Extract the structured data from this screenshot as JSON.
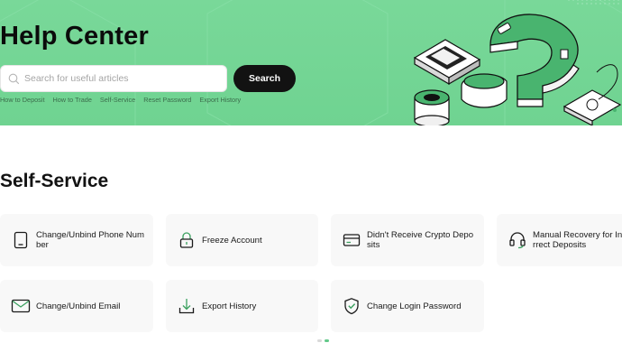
{
  "hero": {
    "title": "Help Center",
    "search_placeholder": "Search for useful articles",
    "search_button": "Search",
    "quick_links": [
      "How to Deposit",
      "How to Trade",
      "Self-Service",
      "Reset Password",
      "Export History"
    ]
  },
  "section": {
    "title": "Self-Service"
  },
  "cards": [
    {
      "label": "Change/Unbind Phone Number",
      "icon": "phone-icon"
    },
    {
      "label": "Freeze Account",
      "icon": "lock-icon"
    },
    {
      "label": "Didn't Receive Crypto Deposits",
      "icon": "card-icon"
    },
    {
      "label": "Manual Recovery for Incorrect Deposits",
      "icon": "headset-icon"
    },
    {
      "label": "Change/Unbind Email",
      "icon": "mail-icon"
    },
    {
      "label": "Export History",
      "icon": "download-icon"
    },
    {
      "label": "Change Login Password",
      "icon": "shield-check-icon"
    }
  ],
  "colors": {
    "hero_green": "#72d594",
    "accent_green": "#3aa05e",
    "button_black": "#121212",
    "card_bg": "#f8f8f8"
  },
  "pagination": {
    "pages": 2,
    "active": 2
  }
}
